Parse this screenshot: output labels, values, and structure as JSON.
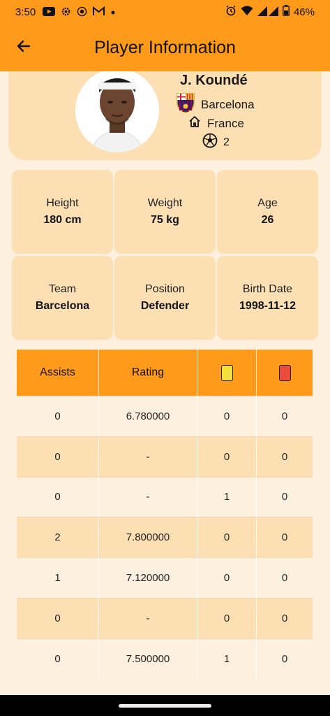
{
  "status": {
    "time": "3:50",
    "battery": "46%",
    "left_icons": [
      "youtube-icon",
      "settings-icon",
      "record-icon",
      "gmail-icon",
      "dot-icon"
    ],
    "right_icons": [
      "alarm-icon",
      "wifi-icon",
      "signal-icon",
      "battery-icon"
    ]
  },
  "appbar": {
    "title": "Player Information",
    "back_icon": "arrow-back-icon"
  },
  "player": {
    "name": "J. Koundé",
    "club": "Barcelona",
    "country": "France",
    "number": "2"
  },
  "info": [
    {
      "label": "Height",
      "value": "180 cm"
    },
    {
      "label": "Weight",
      "value": "75 kg"
    },
    {
      "label": "Age",
      "value": "26"
    },
    {
      "label": "Team",
      "value": "Barcelona"
    },
    {
      "label": "Position",
      "value": "Defender"
    },
    {
      "label": "Birth Date",
      "value": "1998-11-12"
    }
  ],
  "table": {
    "headers": [
      "Assists",
      "Rating"
    ],
    "header_icons": [
      "yellow-card-icon",
      "red-card-icon"
    ],
    "rows": [
      [
        "0",
        "6.780000",
        "0",
        "0"
      ],
      [
        "0",
        "-",
        "0",
        "0"
      ],
      [
        "0",
        "-",
        "1",
        "0"
      ],
      [
        "2",
        "7.800000",
        "0",
        "0"
      ],
      [
        "1",
        "7.120000",
        "0",
        "0"
      ],
      [
        "0",
        "-",
        "0",
        "0"
      ],
      [
        "0",
        "7.500000",
        "1",
        "0"
      ]
    ]
  },
  "colors": {
    "primary": "#FF9A1A",
    "surface": "#FDDFB4",
    "background": "#FDF0DF",
    "yellow_card": "#F5E13A",
    "red_card": "#EE4B3C"
  }
}
